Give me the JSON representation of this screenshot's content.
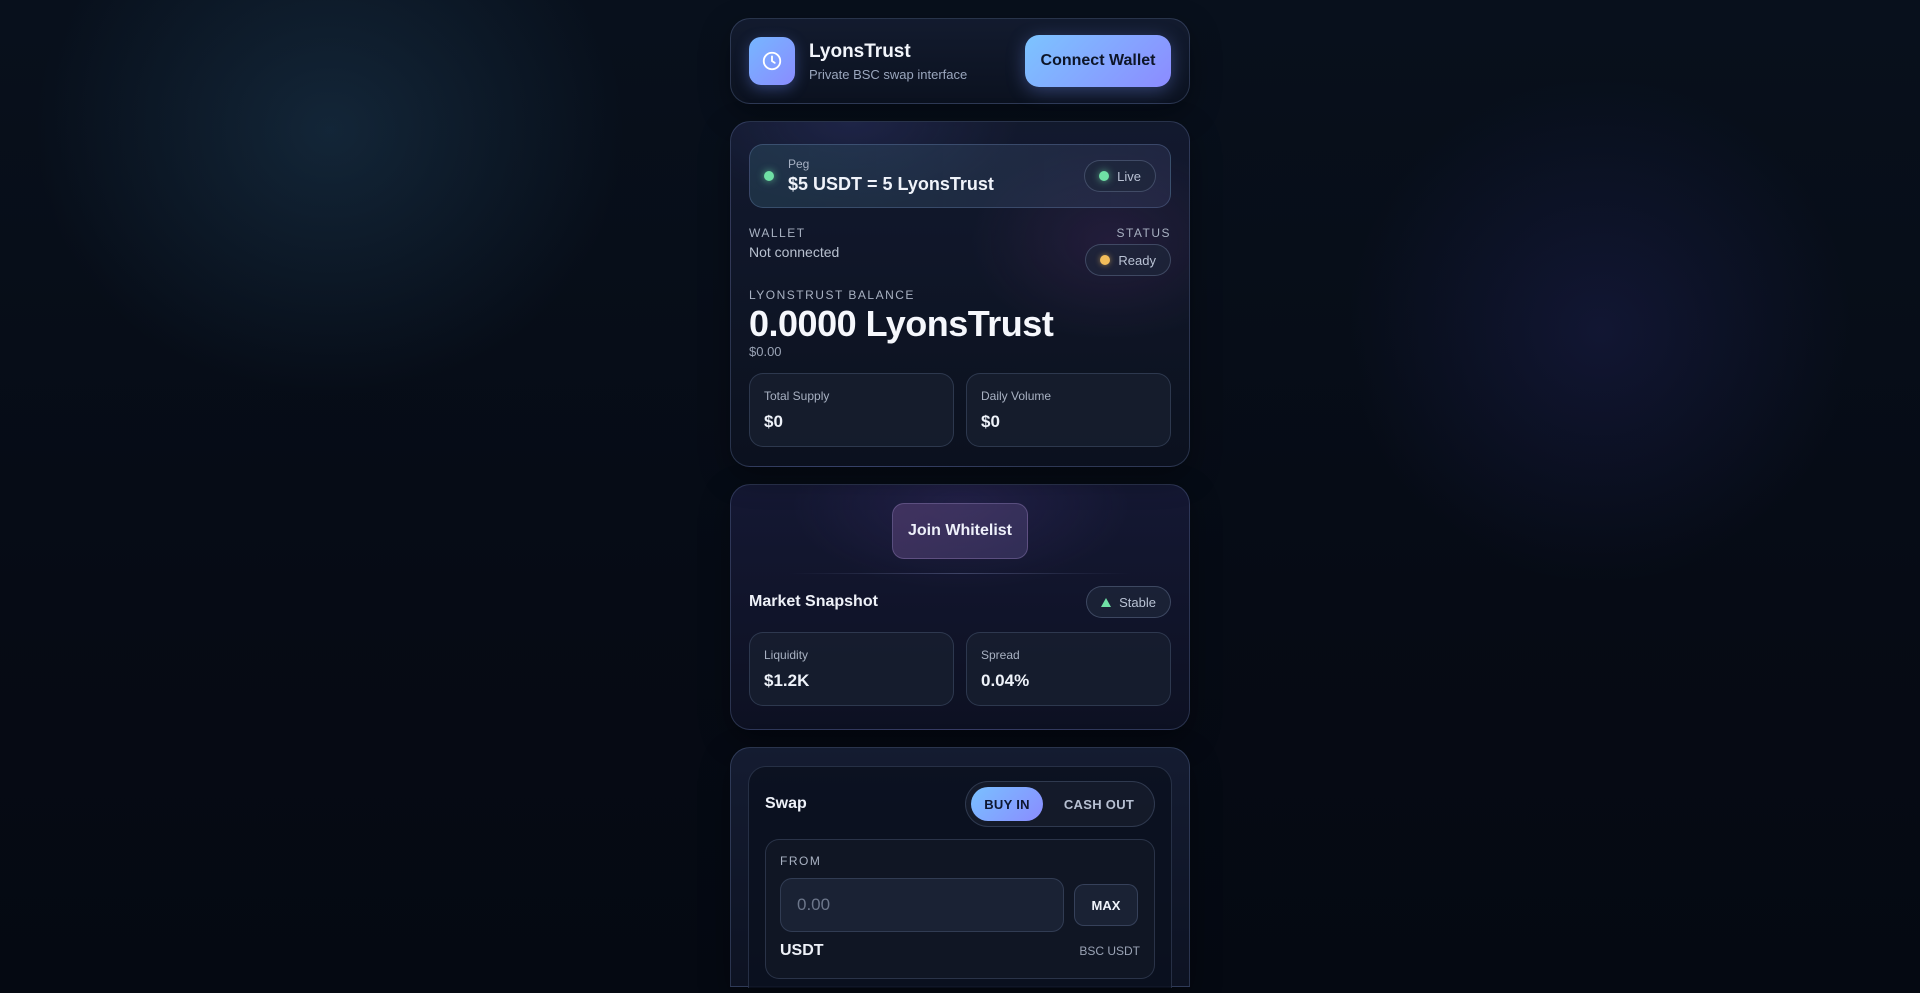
{
  "header": {
    "brand_name": "LyonsTrust",
    "brand_sub": "Private BSC swap interface",
    "connect_label": "Connect Wallet",
    "logo_icon": "clock-icon"
  },
  "balance": {
    "peg_label": "Peg",
    "peg_value": "$5 USDT = 5 LyonsTrust",
    "live_label": "Live",
    "wallet_label": "WALLET",
    "wallet_value": "Not connected",
    "status_label": "STATUS",
    "status_value": "Ready",
    "balance_label": "LYONSTRUST BALANCE",
    "balance_value": "0.0000 LyonsTrust",
    "balance_usd": "$0.00",
    "stats": [
      {
        "label": "Total Supply",
        "value": "$0"
      },
      {
        "label": "Daily Volume",
        "value": "$0"
      }
    ]
  },
  "whitelist": {
    "join_label": "Join Whitelist",
    "market_title": "Market Snapshot",
    "trend_label": "Stable",
    "stats": [
      {
        "label": "Liquidity",
        "value": "$1.2K"
      },
      {
        "label": "Spread",
        "value": "0.04%"
      }
    ]
  },
  "swap": {
    "title": "Swap",
    "tabs": [
      {
        "label": "BUY IN",
        "active": true
      },
      {
        "label": "CASH OUT",
        "active": false
      }
    ],
    "from_label": "FROM",
    "amount_placeholder": "0.00",
    "max_label": "MAX",
    "token_name": "USDT",
    "token_network": "BSC USDT"
  },
  "colors": {
    "accent_start": "#79c0ff",
    "accent_end": "#8a8cff",
    "live_green": "#6fe0a5",
    "ready_amber": "#f3bd5a"
  }
}
